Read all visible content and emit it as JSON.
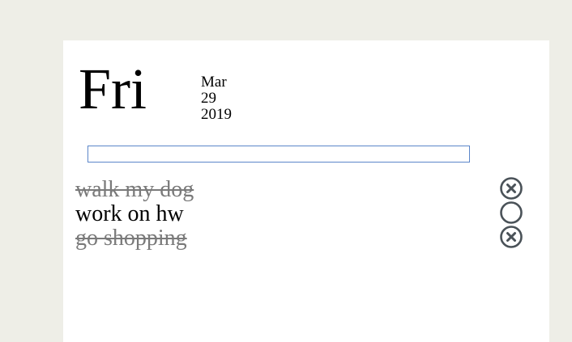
{
  "header": {
    "day": "Fri",
    "month": "Mar",
    "date": "29",
    "year": "2019"
  },
  "new_todo": {
    "value": "",
    "placeholder": ""
  },
  "todos": [
    {
      "text": "walk my dog",
      "done": true
    },
    {
      "text": "work on hw",
      "done": false
    },
    {
      "text": "go shopping",
      "done": true
    }
  ],
  "icons": {
    "done": "circle-x-icon",
    "open": "circle-icon"
  },
  "colors": {
    "background": "#eeeee7",
    "card": "#ffffff",
    "done_text": "#7a7a7a",
    "icon_stroke": "#4a5258",
    "input_border": "#5b86c9"
  }
}
